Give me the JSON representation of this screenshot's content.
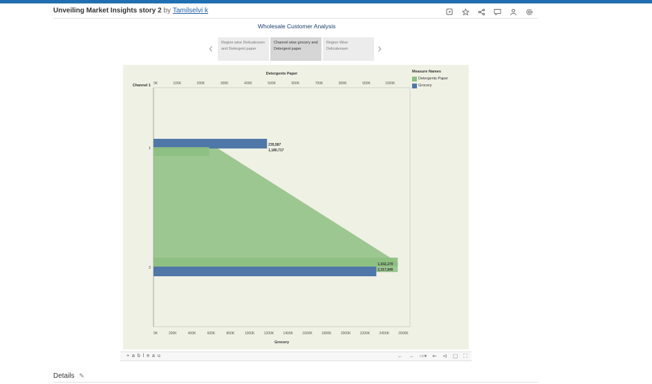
{
  "header": {
    "title": "Unveiling Market Insights story 2",
    "by": "by",
    "author": "Tamilselvi k",
    "icons": [
      "sheet-swap-icon",
      "star-icon",
      "share-icon",
      "comment-icon",
      "people-icon",
      "settings-icon"
    ]
  },
  "story": {
    "title": "Wholesale Customer Analysis",
    "points": [
      "Region wise Delicatessen and Detergent paper",
      "Channel wise grocery and Detergent paper",
      "Region Wise Delicatessen"
    ],
    "active_index": 1
  },
  "chart_data": {
    "type": "bar",
    "row_header": "Channel",
    "categories": [
      "1",
      "2"
    ],
    "top_axis_label": "Detergents Paper",
    "bottom_axis_label": "Grocery",
    "top_ticks": [
      "0K",
      "100K",
      "200K",
      "300K",
      "400K",
      "500K",
      "600K",
      "700K",
      "800K",
      "900K",
      "1000K"
    ],
    "bottom_ticks": [
      "0K",
      "200K",
      "400K",
      "600K",
      "800K",
      "1000K",
      "1200K",
      "1400K",
      "1600K",
      "1800K",
      "2000K",
      "2200K",
      "2400K",
      "2600K"
    ],
    "top_range": [
      0,
      1084000
    ],
    "bottom_range": [
      0,
      2668000
    ],
    "series": [
      {
        "name": "Detergents Paper",
        "axis": "top",
        "color": "#8ebf82",
        "values": [
          235587,
          1032270
        ],
        "labels": [
          "235,587",
          "1,032,270"
        ]
      },
      {
        "name": "Grocery",
        "axis": "bottom",
        "color": "#4f78a8",
        "values": [
          1180717,
          2317845
        ],
        "labels": [
          "1,180,717",
          "2,317,845"
        ]
      }
    ],
    "legend_title": "Measure Names",
    "legend_position": "right",
    "grid": false
  },
  "toolbar": {
    "brand": "+ a b l e a u",
    "icons": [
      "undo-icon",
      "redo-icon",
      "revert-icon",
      "reset-icon",
      "share-icon",
      "comment-icon",
      "fullscreen-icon"
    ]
  },
  "details": {
    "label": "Details"
  }
}
